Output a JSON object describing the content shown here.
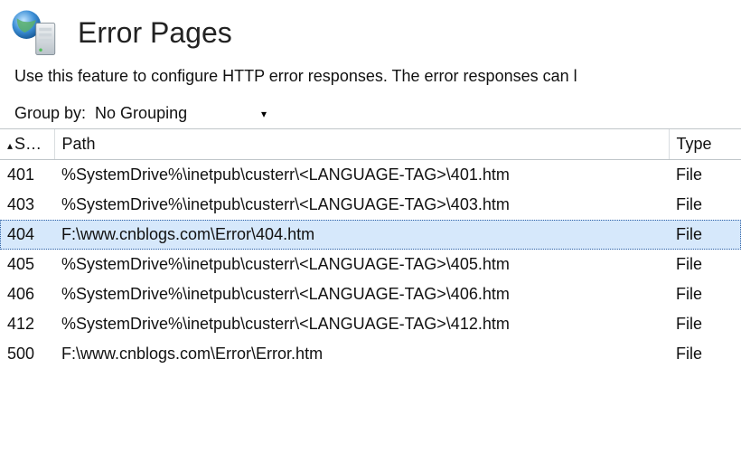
{
  "page": {
    "title": "Error Pages",
    "description": "Use this feature to configure HTTP error responses. The error responses can l"
  },
  "groupby": {
    "label": "Group by:",
    "value": "No Grouping"
  },
  "columns": {
    "status": "S…",
    "path": "Path",
    "type": "Type"
  },
  "rows": [
    {
      "status": "401",
      "path": "%SystemDrive%\\inetpub\\custerr\\<LANGUAGE-TAG>\\401.htm",
      "type": "File",
      "selected": false
    },
    {
      "status": "403",
      "path": "%SystemDrive%\\inetpub\\custerr\\<LANGUAGE-TAG>\\403.htm",
      "type": "File",
      "selected": false
    },
    {
      "status": "404",
      "path": "F:\\www.cnblogs.com\\Error\\404.htm",
      "type": "File",
      "selected": true
    },
    {
      "status": "405",
      "path": "%SystemDrive%\\inetpub\\custerr\\<LANGUAGE-TAG>\\405.htm",
      "type": "File",
      "selected": false
    },
    {
      "status": "406",
      "path": "%SystemDrive%\\inetpub\\custerr\\<LANGUAGE-TAG>\\406.htm",
      "type": "File",
      "selected": false
    },
    {
      "status": "412",
      "path": "%SystemDrive%\\inetpub\\custerr\\<LANGUAGE-TAG>\\412.htm",
      "type": "File",
      "selected": false
    },
    {
      "status": "500",
      "path": "F:\\www.cnblogs.com\\Error\\Error.htm",
      "type": "File",
      "selected": false
    }
  ]
}
